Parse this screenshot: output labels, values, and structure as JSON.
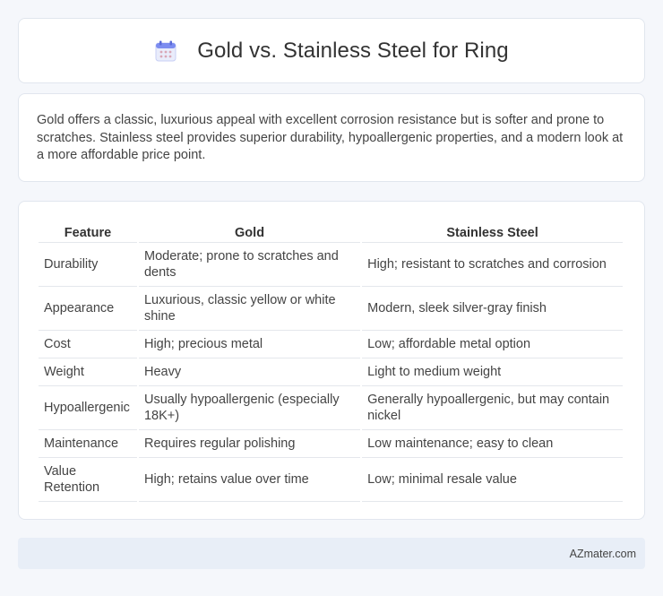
{
  "header": {
    "title": "Gold vs. Stainless Steel for Ring",
    "icon": "calendar-icon",
    "icon_colors": {
      "top": "#7c8cf0",
      "body": "#e9ecfb",
      "dots": "#d9a7b7"
    }
  },
  "description": "Gold offers a classic, luxurious appeal with excellent corrosion resistance but is softer and prone to scratches. Stainless steel provides superior durability, hypoallergenic properties, and a modern look at a more affordable price point.",
  "table": {
    "headers": [
      "Feature",
      "Gold",
      "Stainless Steel"
    ],
    "rows": [
      [
        "Durability",
        "Moderate; prone to scratches and dents",
        "High; resistant to scratches and corrosion"
      ],
      [
        "Appearance",
        "Luxurious, classic yellow or white shine",
        "Modern, sleek silver-gray finish"
      ],
      [
        "Cost",
        "High; precious metal",
        "Low; affordable metal option"
      ],
      [
        "Weight",
        "Heavy",
        "Light to medium weight"
      ],
      [
        "Hypoallergenic",
        "Usually hypoallergenic (especially 18K+)",
        "Generally hypoallergenic, but may contain nickel"
      ],
      [
        "Maintenance",
        "Requires regular polishing",
        "Low maintenance; easy to clean"
      ],
      [
        "Value Retention",
        "High; retains value over time",
        "Low; minimal resale value"
      ]
    ]
  },
  "footer": {
    "brand": "AZmater.com"
  }
}
